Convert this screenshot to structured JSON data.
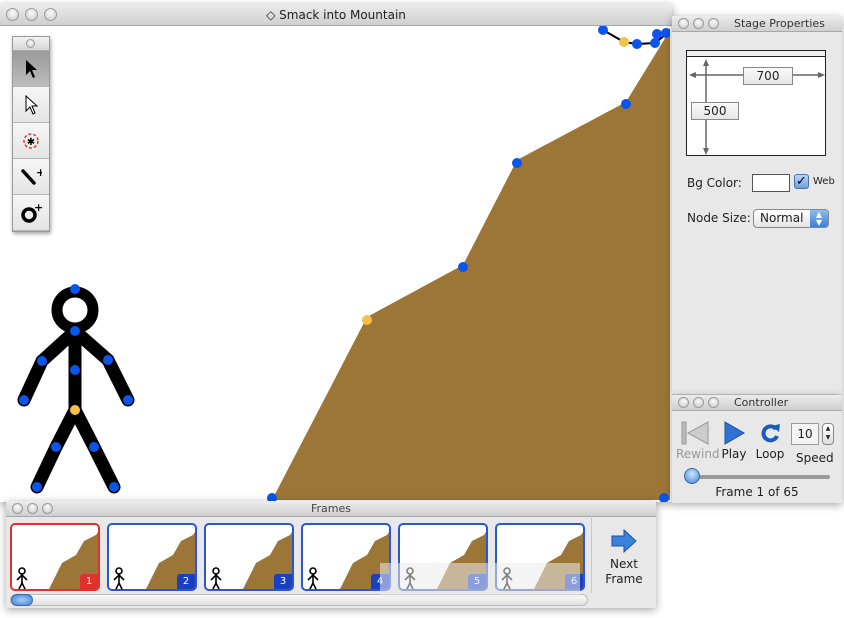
{
  "main_window": {
    "title": "Smack into Mountain",
    "title_icon": "diamond-icon"
  },
  "toolbox": {
    "tools": [
      {
        "name": "select-tool",
        "icon": "arrow-filled-icon",
        "active": true
      },
      {
        "name": "direct-select-tool",
        "icon": "arrow-outline-icon",
        "active": false
      },
      {
        "name": "edit-node-tool",
        "icon": "node-circle-icon",
        "active": false
      },
      {
        "name": "add-line-tool",
        "icon": "add-line-icon",
        "active": false
      },
      {
        "name": "add-circle-tool",
        "icon": "add-circle-icon",
        "active": false
      }
    ]
  },
  "stage": {
    "background": "#ffffff",
    "mountain_color": "#9b7637",
    "node_color": "#0a55ea",
    "pivot_color": "#f5c04a"
  },
  "stage_properties": {
    "title": "Stage Properties",
    "width": "700",
    "height": "500",
    "bg_color_label": "Bg Color:",
    "bg_color_value": "#ffffff",
    "web_label": "Web",
    "web_checked": true,
    "node_size_label": "Node Size:",
    "node_size_value": "Normal"
  },
  "controller": {
    "title": "Controller",
    "rewind_label": "Rewind",
    "play_label": "Play",
    "loop_label": "Loop",
    "speed_label": "Speed",
    "speed_value": "10",
    "frame_position": 0.0,
    "frame_label": "Frame 1 of 65"
  },
  "frames_window": {
    "title": "Frames",
    "frames": [
      {
        "number": "1",
        "selected": true
      },
      {
        "number": "2",
        "selected": false
      },
      {
        "number": "3",
        "selected": false
      },
      {
        "number": "4",
        "selected": false
      },
      {
        "number": "5",
        "selected": false
      },
      {
        "number": "6",
        "selected": false
      }
    ],
    "next_frame_line1": "Next",
    "next_frame_line2": "Frame"
  }
}
